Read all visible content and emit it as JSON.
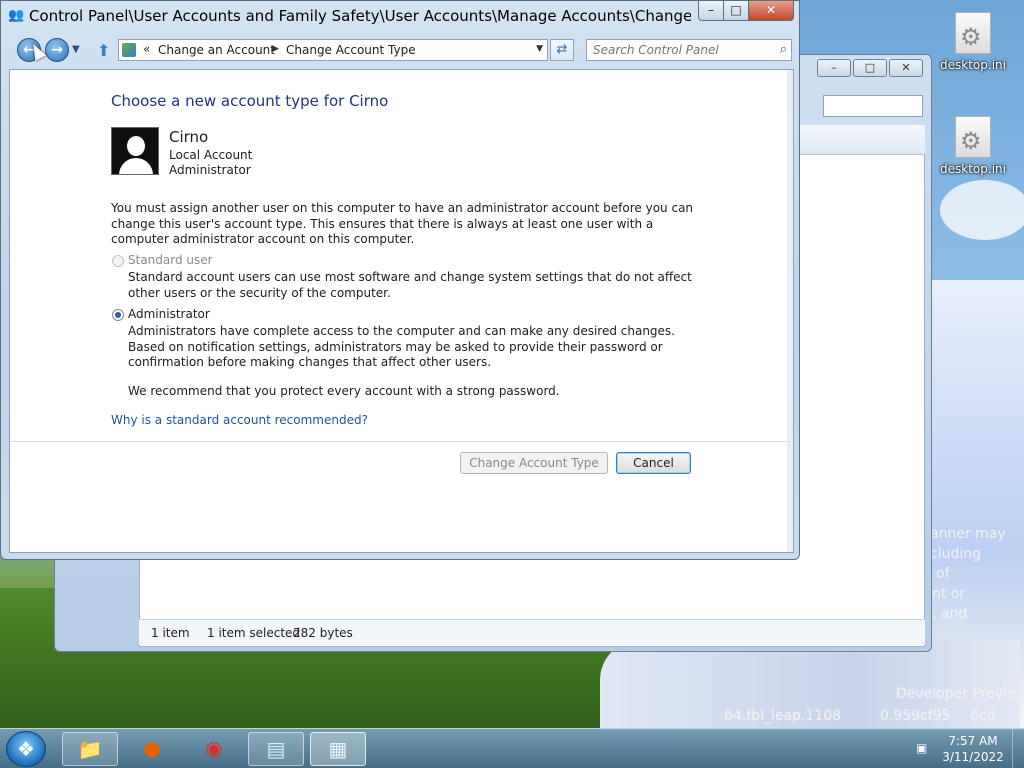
{
  "desktop": {
    "icons": [
      {
        "label": "desktop.ini"
      },
      {
        "label": "desktop.ini"
      }
    ],
    "wallpaper_fragments": [
      "anner may",
      "cluding",
      "of",
      "nt or",
      ", and",
      "Developer Previe",
      "64.fbl_leap.1108",
      "0.959cf95",
      "6cd"
    ]
  },
  "back_window": {
    "status": {
      "items": "1 item",
      "selected": "1 item selected",
      "size": "282 bytes"
    }
  },
  "window": {
    "title": "Control Panel\\User Accounts and Family Safety\\User Accounts\\Manage Accounts\\Change an Accou...",
    "controls": {
      "minimize": "–",
      "maximize": "□",
      "close": "✕"
    }
  },
  "nav": {
    "breadcrumbs": [
      "Change an Account",
      "Change Account Type"
    ],
    "overflow_glyph": "«",
    "search_placeholder": "Search Control Panel"
  },
  "page": {
    "heading": "Choose a new account type for Cirno",
    "account": {
      "name": "Cirno",
      "type": "Local Account",
      "group": "Administrator"
    },
    "notice": "You must assign another user on this computer to have an administrator account before you can change this user's account type. This ensures that there is always at least one user with a computer administrator account on this computer.",
    "options": [
      {
        "label": "Standard user",
        "description": "Standard account users can use most software and change system settings that do not affect other users or the security of the computer.",
        "selected": false,
        "disabled": true
      },
      {
        "label": "Administrator",
        "description": "Administrators have complete access to the computer and can make any desired changes. Based on notification settings, administrators may be asked to provide their password or confirmation before making changes that affect other users.",
        "selected": true,
        "disabled": false
      }
    ],
    "recommendation": "We recommend that you protect every account with a strong password.",
    "help_link": "Why is a standard account recommended?",
    "buttons": {
      "change": "Change Account Type",
      "cancel": "Cancel"
    }
  },
  "taskbar": {
    "items": [
      "Windows Explorer",
      "Firefox",
      "Chrome",
      "Notepad",
      "Control Panel"
    ],
    "clock": {
      "time": "7:57 AM",
      "date": "3/11/2022"
    }
  }
}
